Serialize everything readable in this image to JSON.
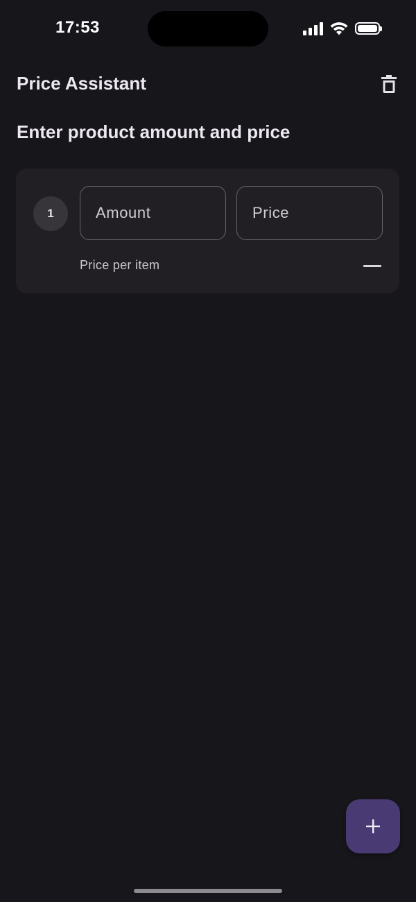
{
  "status_bar": {
    "time": "17:53",
    "icons": [
      "signal-icon",
      "wifi-icon",
      "battery-icon"
    ]
  },
  "app_bar": {
    "title": "Price Assistant",
    "action_icon": "trash-icon"
  },
  "main": {
    "heading": "Enter product amount and price",
    "items": [
      {
        "index": "1",
        "amount_placeholder": "Amount",
        "amount_value": "",
        "price_placeholder": "Price",
        "price_value": "",
        "price_per_item_label": "Price per item",
        "remove_icon": "minus-icon"
      }
    ]
  },
  "fab": {
    "icon": "plus-icon"
  },
  "colors": {
    "background": "#17161b",
    "card": "#221f24",
    "fab": "#4a3a73",
    "badge": "#37353a"
  }
}
